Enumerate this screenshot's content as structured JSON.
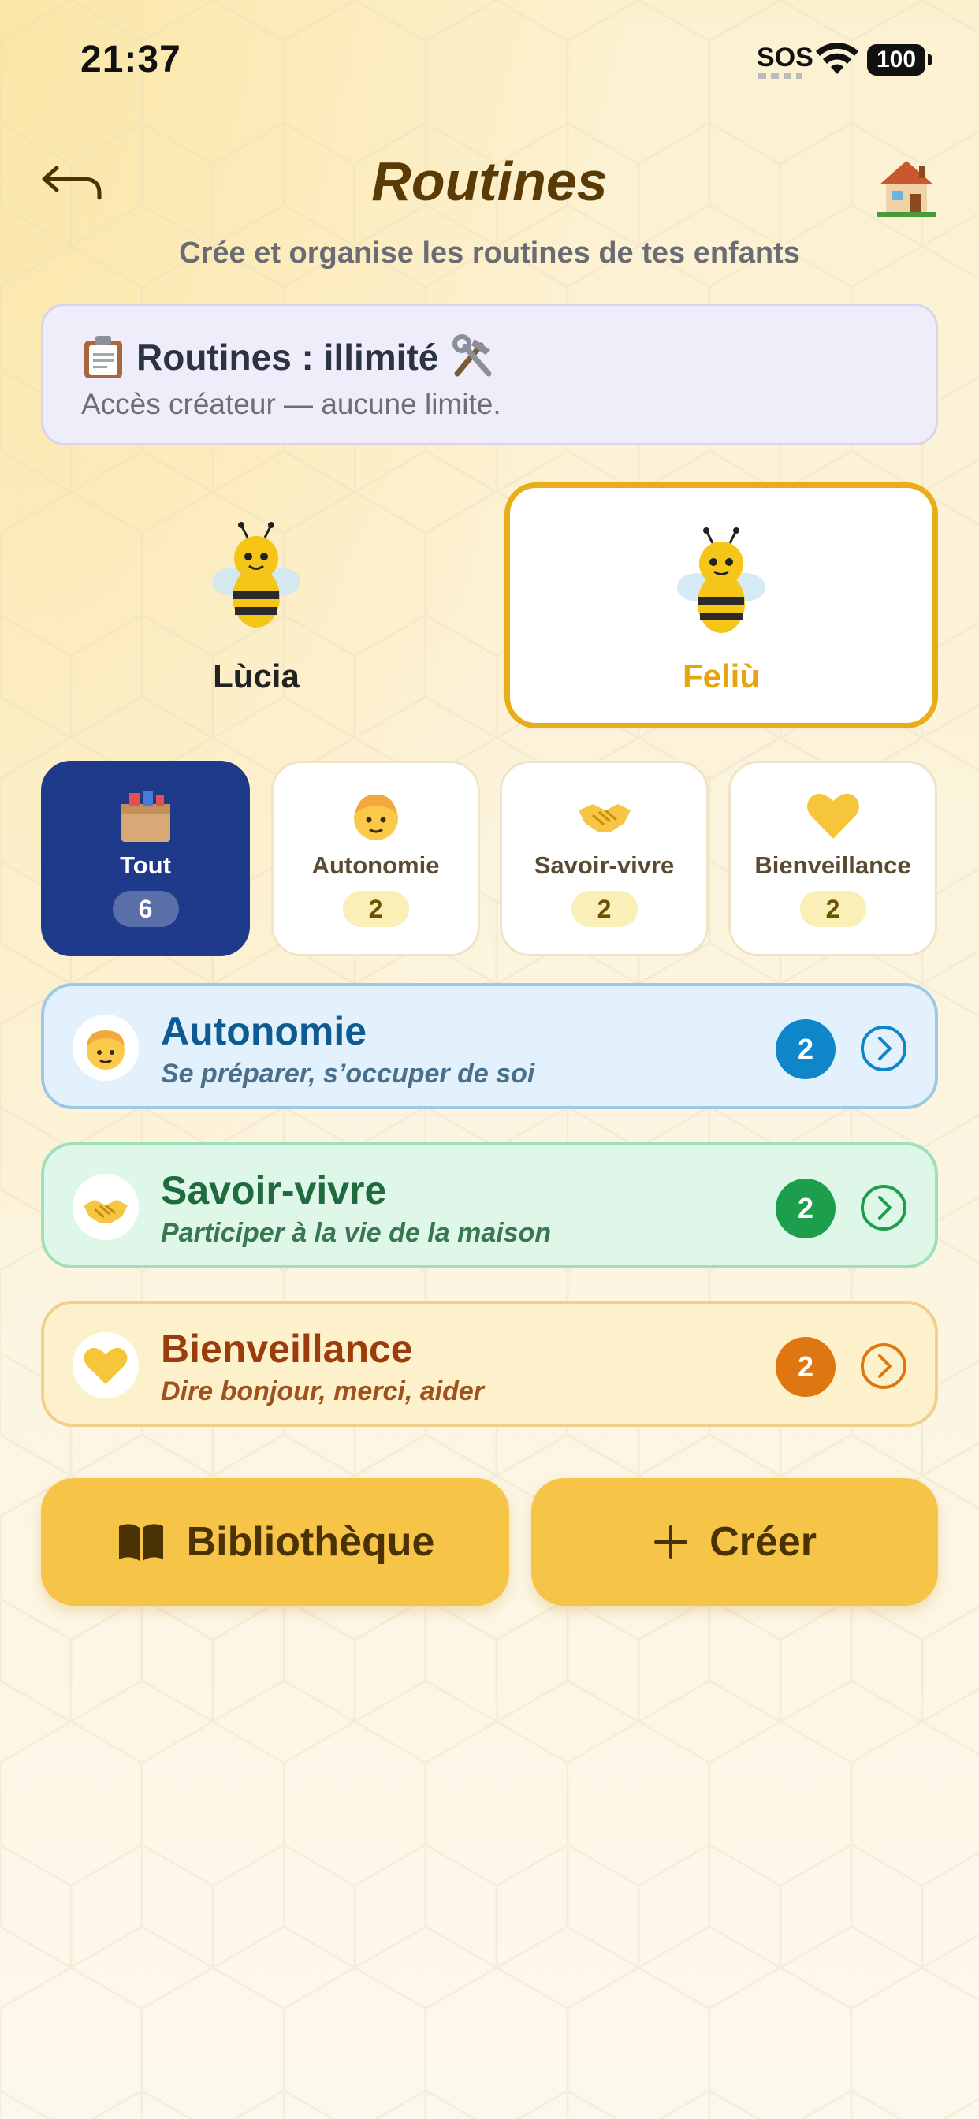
{
  "status_bar": {
    "time": "21:37",
    "sos": "SOS",
    "battery": "100"
  },
  "header": {
    "title": "Routines",
    "subtitle": "Crée et organise les routines de tes enfants"
  },
  "quota": {
    "title": "Routines : illimité",
    "subtitle": "Accès créateur — aucune limite."
  },
  "children": [
    {
      "name": "Lùcia",
      "selected": false
    },
    {
      "name": "Feliù",
      "selected": true
    }
  ],
  "filters": [
    {
      "label": "Tout",
      "count": "6",
      "icon": "box-icon",
      "selected": true
    },
    {
      "label": "Autonomie",
      "count": "2",
      "icon": "boy-icon",
      "selected": false
    },
    {
      "label": "Savoir-vivre",
      "count": "2",
      "icon": "handshake-icon",
      "selected": false
    },
    {
      "label": "Bienveillance",
      "count": "2",
      "icon": "heart-icon",
      "selected": false
    }
  ],
  "categories": [
    {
      "title": "Autonomie",
      "subtitle": "Se préparer, s’occuper de soi",
      "count": "2",
      "icon": "boy-icon",
      "color": "#0f86c9"
    },
    {
      "title": "Savoir-vivre",
      "subtitle": "Participer à la vie de la maison",
      "count": "2",
      "icon": "handshake-icon",
      "color": "#1c9e4d"
    },
    {
      "title": "Bienveillance",
      "subtitle": "Dire bonjour, merci, aider",
      "count": "2",
      "icon": "heart-icon",
      "color": "#de7611"
    }
  ],
  "actions": {
    "library_label": "Bibliothèque",
    "create_label": "Créer"
  },
  "colors": {
    "accent": "#f6c548",
    "selected_border": "#e8ae1a",
    "navy": "#1f3a8a",
    "title_brown": "#5a3b06"
  }
}
